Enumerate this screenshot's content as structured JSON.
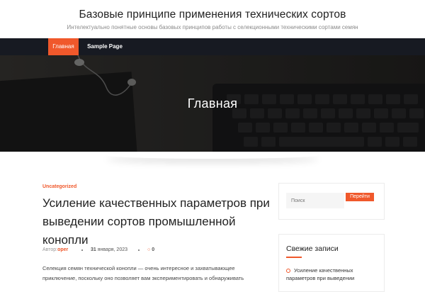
{
  "site": {
    "title": "Базовые принципе применения технических сортов",
    "description": "Интелектуально понятные основы базовых принципов работы с селекционными техническими сортами семян"
  },
  "nav": {
    "items": [
      {
        "label": "Главная"
      },
      {
        "label": "Sample Page"
      }
    ]
  },
  "hero": {
    "title": "Главная"
  },
  "post": {
    "category": "Uncategorized",
    "title": "Усиление качественных параметров при выведении сортов промышленной конопли",
    "meta": {
      "author_label": "Автор:",
      "author": "oper",
      "date_day": "31",
      "date_rest": "января, 2023",
      "comments": "0"
    },
    "excerpt": "Селекция семян технической конопли — очень интересное и захватывающее приключение, поскольку оно позволяет вам экспериментировать и обнаруживать"
  },
  "sidebar": {
    "search": {
      "placeholder": "Поиск",
      "button": "Перейти"
    },
    "recent": {
      "title": "Свежие записи",
      "items": [
        {
          "label": "Усиление качественных параметров при выведении"
        }
      ]
    }
  },
  "colors": {
    "accent": "#f0582b",
    "nav_bg": "#171a22"
  }
}
